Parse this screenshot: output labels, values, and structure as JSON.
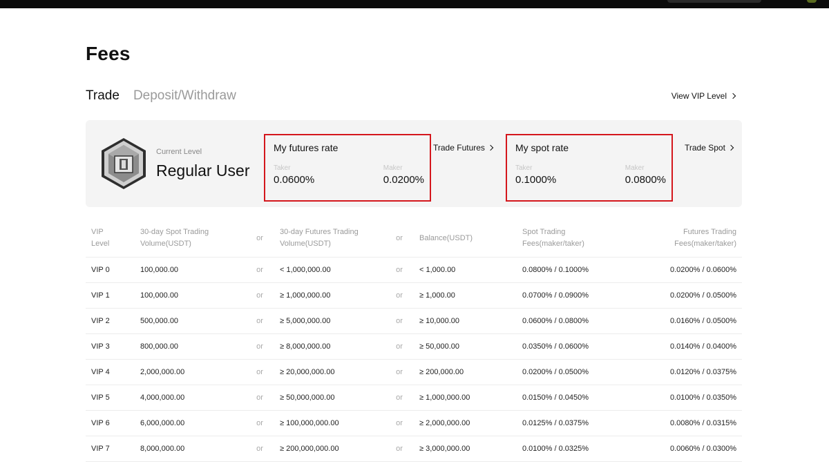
{
  "page": {
    "title": "Fees"
  },
  "tabs": [
    {
      "label": "Trade",
      "active": true
    },
    {
      "label": "Deposit/Withdraw",
      "active": false
    }
  ],
  "vip_link": "View VIP Level",
  "level": {
    "label": "Current Level",
    "value": "Regular User"
  },
  "futures_rate": {
    "title": "My futures rate",
    "taker_label": "Taker",
    "taker_value": "0.0600%",
    "maker_label": "Maker",
    "maker_value": "0.0200%",
    "link": "Trade Futures"
  },
  "spot_rate": {
    "title": "My spot rate",
    "taker_label": "Taker",
    "taker_value": "0.1000%",
    "maker_label": "Maker",
    "maker_value": "0.0800%",
    "link": "Trade Spot"
  },
  "table": {
    "headers": {
      "vip": [
        "VIP",
        "Level"
      ],
      "spot_volume": [
        "30-day Spot Trading",
        "Volume(USDT)"
      ],
      "or1": "or",
      "futures_volume": [
        "30-day Futures Trading",
        "Volume(USDT)"
      ],
      "or2": "or",
      "balance": "Balance(USDT)",
      "spot_fees": [
        "Spot Trading",
        "Fees(maker/taker)"
      ],
      "futures_fees": [
        "Futures Trading",
        "Fees(maker/taker)"
      ]
    },
    "rows": [
      {
        "level": "VIP 0",
        "spot_volume": "100,000.00",
        "or1": "or",
        "futures_volume": "< 1,000,000.00",
        "or2": "or",
        "balance": "< 1,000.00",
        "spot_fees": "0.0800% / 0.1000%",
        "futures_fees": "0.0200% / 0.0600%"
      },
      {
        "level": "VIP 1",
        "spot_volume": "100,000.00",
        "or1": "or",
        "futures_volume": "≥ 1,000,000.00",
        "or2": "or",
        "balance": "≥ 1,000.00",
        "spot_fees": "0.0700% / 0.0900%",
        "futures_fees": "0.0200% / 0.0500%"
      },
      {
        "level": "VIP 2",
        "spot_volume": "500,000.00",
        "or1": "or",
        "futures_volume": "≥ 5,000,000.00",
        "or2": "or",
        "balance": "≥ 10,000.00",
        "spot_fees": "0.0600% / 0.0800%",
        "futures_fees": "0.0160% / 0.0500%"
      },
      {
        "level": "VIP 3",
        "spot_volume": "800,000.00",
        "or1": "or",
        "futures_volume": "≥ 8,000,000.00",
        "or2": "or",
        "balance": "≥ 50,000.00",
        "spot_fees": "0.0350% / 0.0600%",
        "futures_fees": "0.0140% / 0.0400%"
      },
      {
        "level": "VIP 4",
        "spot_volume": "2,000,000.00",
        "or1": "or",
        "futures_volume": "≥ 20,000,000.00",
        "or2": "or",
        "balance": "≥ 200,000.00",
        "spot_fees": "0.0200% / 0.0500%",
        "futures_fees": "0.0120% / 0.0375%"
      },
      {
        "level": "VIP 5",
        "spot_volume": "4,000,000.00",
        "or1": "or",
        "futures_volume": "≥ 50,000,000.00",
        "or2": "or",
        "balance": "≥ 1,000,000.00",
        "spot_fees": "0.0150% / 0.0450%",
        "futures_fees": "0.0100% / 0.0350%"
      },
      {
        "level": "VIP 6",
        "spot_volume": "6,000,000.00",
        "or1": "or",
        "futures_volume": "≥ 100,000,000.00",
        "or2": "or",
        "balance": "≥ 2,000,000.00",
        "spot_fees": "0.0125% / 0.0375%",
        "futures_fees": "0.0080% / 0.0315%"
      },
      {
        "level": "VIP 7",
        "spot_volume": "8,000,000.00",
        "or1": "or",
        "futures_volume": "≥ 200,000,000.00",
        "or2": "or",
        "balance": "≥ 3,000,000.00",
        "spot_fees": "0.0100% / 0.0325%",
        "futures_fees": "0.0060% / 0.0300%"
      }
    ]
  },
  "colors": {
    "highlight_border": "#d4161c",
    "panel_bg": "#f4f4f4",
    "topbar": "#0b0b0b"
  }
}
